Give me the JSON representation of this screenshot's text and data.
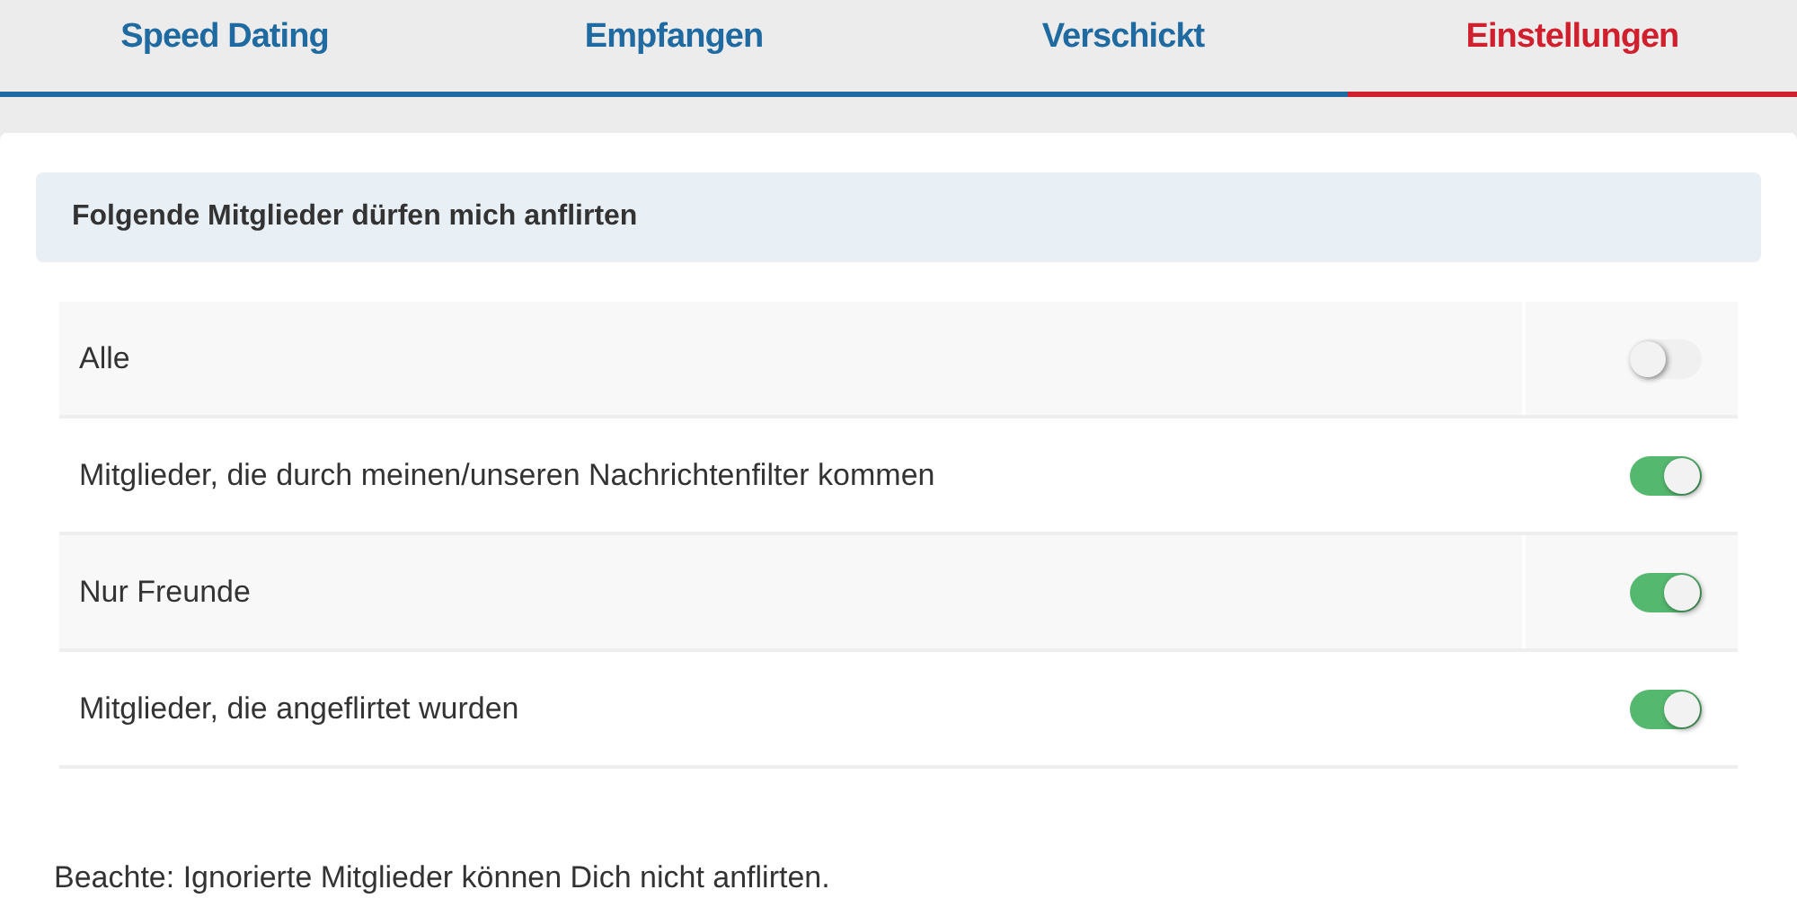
{
  "tabs": [
    {
      "label": "Speed Dating",
      "selected": false
    },
    {
      "label": "Empfangen",
      "selected": false
    },
    {
      "label": "Verschickt",
      "selected": false
    },
    {
      "label": "Einstellungen",
      "selected": true
    }
  ],
  "section": {
    "title": "Folgende Mitglieder dürfen mich anflirten",
    "options": [
      {
        "label": "Alle",
        "on": false
      },
      {
        "label": "Mitglieder, die durch meinen/unseren Nachrichtenfilter kommen",
        "on": true
      },
      {
        "label": "Nur Freunde",
        "on": true
      },
      {
        "label": "Mitglieder, die angeflirtet wurden",
        "on": true
      }
    ]
  },
  "note": "Beachte: Ignorierte Mitglieder können Dich nicht anflirten."
}
